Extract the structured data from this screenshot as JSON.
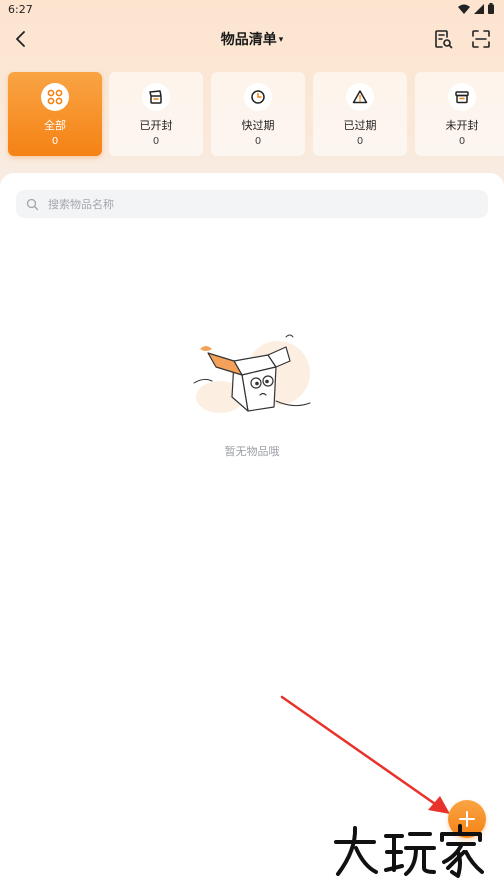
{
  "status_bar": {
    "time": "6:27"
  },
  "header": {
    "title": "物品清单"
  },
  "categories": [
    {
      "label": "全部",
      "count": "0",
      "icon": "grid-icon",
      "active": true
    },
    {
      "label": "已开封",
      "count": "0",
      "icon": "opened-box-icon",
      "active": false
    },
    {
      "label": "快过期",
      "count": "0",
      "icon": "clock-icon",
      "active": false
    },
    {
      "label": "已过期",
      "count": "0",
      "icon": "warning-icon",
      "active": false
    },
    {
      "label": "未开封",
      "count": "0",
      "icon": "sealed-box-icon",
      "active": false
    }
  ],
  "search": {
    "placeholder": "搜索物品名称",
    "value": ""
  },
  "empty_state": {
    "text": "暂无物品哦"
  },
  "watermark": {
    "text": "大玩家"
  },
  "colors": {
    "accent": "#f58214",
    "arrow": "#e8322b"
  }
}
